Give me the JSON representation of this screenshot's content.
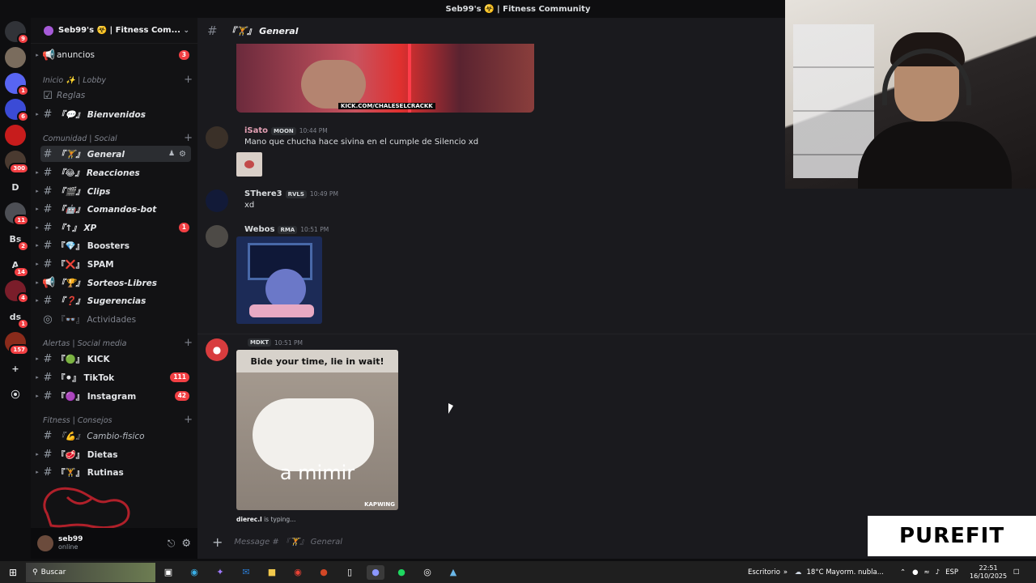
{
  "window": {
    "title": "Seb99's ☣️ | Fitness Community"
  },
  "rail": {
    "servers": [
      {
        "label": "",
        "badge": "9",
        "color": "#313338"
      },
      {
        "label": "",
        "badge": "",
        "color": "#7a6c5d"
      },
      {
        "label": "",
        "badge": "1",
        "color": "#5865f2"
      },
      {
        "label": "",
        "badge": "6",
        "color": "#3b4bd6"
      },
      {
        "label": "",
        "badge": "",
        "color": "#c71c1c"
      },
      {
        "label": "",
        "badge": "300",
        "color": "#4a3a30"
      },
      {
        "label": "D",
        "badge": "",
        "color": "#0e0e10"
      },
      {
        "label": "",
        "badge": "11",
        "color": "#4d4f55"
      },
      {
        "label": "Bs",
        "badge": "2",
        "color": "#0e0e10"
      },
      {
        "label": "A",
        "badge": "14",
        "color": "#0e0e10"
      },
      {
        "label": "",
        "badge": "4",
        "color": "#7a1d2a"
      },
      {
        "label": "ds",
        "badge": "1",
        "color": "#0e0e10"
      },
      {
        "label": "",
        "badge": "157",
        "color": "#8a2b1b"
      },
      {
        "label": "+",
        "badge": "",
        "color": "#0e0e10"
      },
      {
        "label": "⦿",
        "badge": "",
        "color": "#0e0e10"
      }
    ]
  },
  "sidebar": {
    "server_name": "Seb99's ☣️ | Fitness Com...",
    "announce": {
      "label": "anuncios",
      "badge": "3"
    },
    "categories": [
      {
        "label": "Inicio ✨ | Lobby"
      },
      {
        "label": "Comunidad | Social"
      },
      {
        "label": "Alertas | Social media"
      },
      {
        "label": "Fitness | Consejos"
      }
    ],
    "channels": [
      {
        "label": "Reglas",
        "badge": ""
      },
      {
        "label": "『💬』 Bienvenidos",
        "badge": ""
      },
      {
        "label": "『🏋』 General",
        "badge": ""
      },
      {
        "label": "『😂』 Reacciones",
        "badge": ""
      },
      {
        "label": "『🎬』 Clips",
        "badge": ""
      },
      {
        "label": "『🤖』 Comandos-bot",
        "badge": ""
      },
      {
        "label": "『↑』 XP",
        "badge": "1"
      },
      {
        "label": "『💎』 Boosters",
        "badge": ""
      },
      {
        "label": "『❌』 SPAM",
        "badge": ""
      },
      {
        "label": "『🏆』 Sorteos-Libres",
        "badge": ""
      },
      {
        "label": "『❓』 Sugerencias",
        "badge": ""
      },
      {
        "label": "『👓』 Actividades",
        "badge": ""
      },
      {
        "label": "『🟢』 KICK",
        "badge": ""
      },
      {
        "label": "『⚫』 TikTok",
        "badge": "111"
      },
      {
        "label": "『🟣』 Instagram",
        "badge": "42"
      },
      {
        "label": "『💪』 Cambio-fisico",
        "badge": ""
      },
      {
        "label": "『🥩』 Dietas",
        "badge": ""
      },
      {
        "label": "『🏋』 Rutinas",
        "badge": ""
      }
    ]
  },
  "user": {
    "name": "seb99",
    "status": "online"
  },
  "chat": {
    "channel_title": "『🏋』 General",
    "embed_caption": "KICK.COM/CHALESELCRACKK",
    "messages": [
      {
        "author": "iSato",
        "author_color": "#e4a0b4",
        "tag": "MOON",
        "time": "10:44 PM",
        "text": "Mano que chucha hace sivina en el cumple de Silencio xd"
      },
      {
        "author": "SThere3",
        "author_color": "#dbdee1",
        "tag": "RVLS",
        "time": "10:49 PM",
        "text": "xd"
      },
      {
        "author": "Webos",
        "author_color": "#dbdee1",
        "tag": "RMA",
        "time": "10:51 PM",
        "text": ""
      },
      {
        "author": "",
        "author_color": "#dbdee1",
        "tag": "MDKT",
        "time": "10:51 PM",
        "text": ""
      }
    ],
    "gif": {
      "top_text": "Bide your time, lie in wait!",
      "bottom_text": "a mimir",
      "watermark": "KAPWING"
    },
    "typing": {
      "user": "dierec.l",
      "suffix": " is typing..."
    },
    "composer_placeholder": "Message # 『🏋』 General"
  },
  "overlay": {
    "brand": "PUREFIT"
  },
  "taskbar": {
    "search_label": "Buscar",
    "desktop_label": "Escritorio",
    "weather": "18°C  Mayorm. nubla...",
    "lang": "ESP",
    "time": "22:51",
    "date": "16/10/2025"
  }
}
